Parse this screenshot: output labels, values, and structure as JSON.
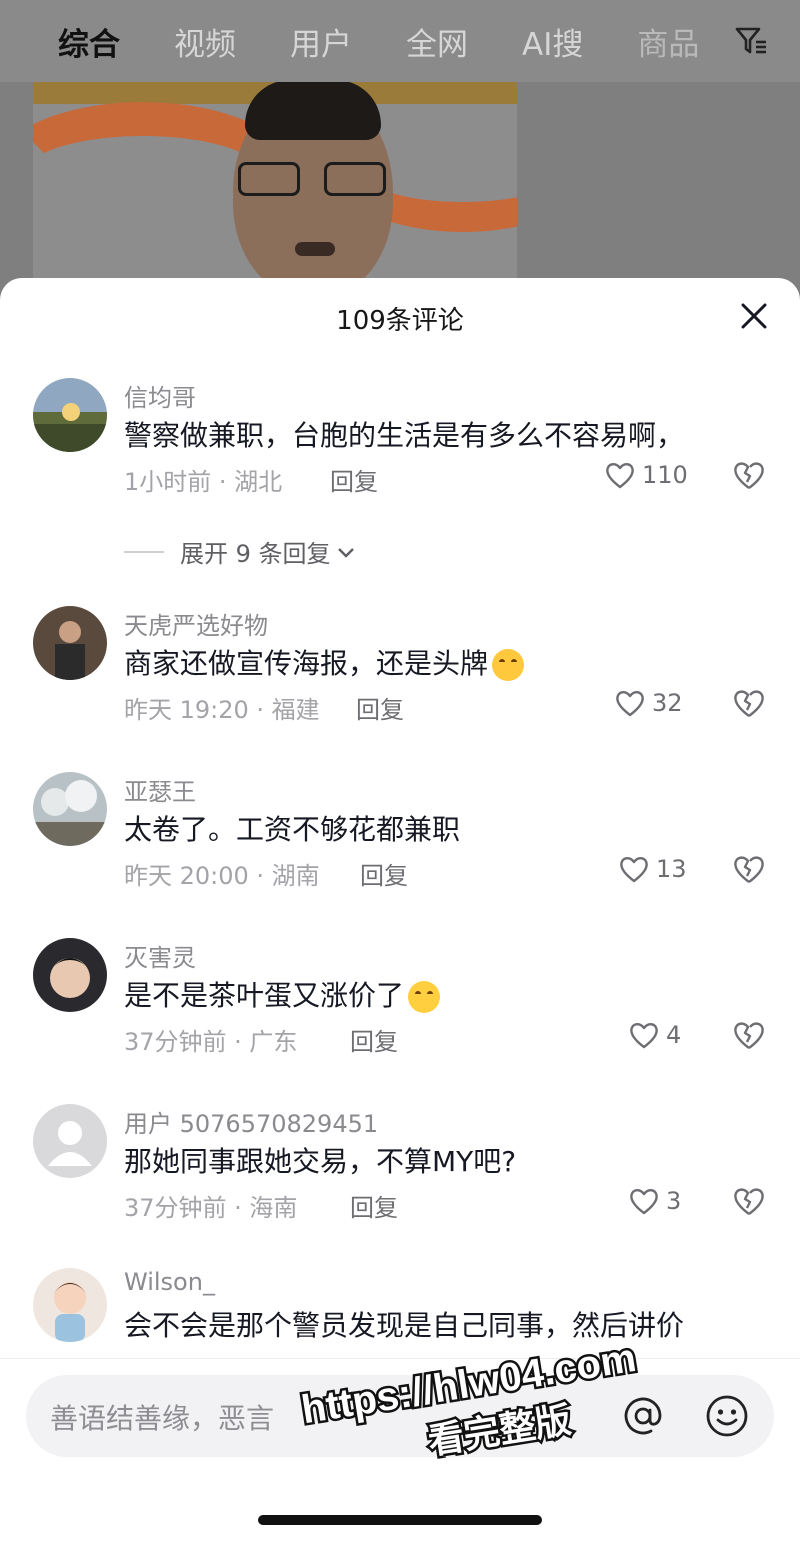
{
  "top_tabs": [
    {
      "label": "综合",
      "active": true
    },
    {
      "label": "视频",
      "active": false
    },
    {
      "label": "用户",
      "active": false
    },
    {
      "label": "全网",
      "active": false
    },
    {
      "label": "AI搜",
      "active": false
    },
    {
      "label": "商品",
      "active": false
    }
  ],
  "filter_icon": "filter-icon",
  "sheet": {
    "title": "109条评论",
    "close_icon": "close-icon"
  },
  "comments": [
    {
      "user": "信均哥",
      "text": "警察做兼职，台胞的生活是有多么不容易啊，",
      "time_location": "1小时前 · 湖北",
      "reply_label": "回复",
      "likes": "110"
    },
    {
      "user": "天虎严选好物",
      "text": "商家还做宣传海报，还是头牌",
      "emoji": "smirk-emoji",
      "time_location": "昨天 19:20 · 福建",
      "reply_label": "回复",
      "likes": "32"
    },
    {
      "user": "亚瑟王",
      "text": "太卷了。工资不够花都兼职",
      "time_location": "昨天 20:00 · 湖南",
      "reply_label": "回复",
      "likes": "13"
    },
    {
      "user": "灭害灵",
      "text": "是不是茶叶蛋又涨价了",
      "emoji": "rofl-emoji",
      "time_location": "37分钟前 · 广东",
      "reply_label": "回复",
      "likes": "4"
    },
    {
      "user": "用户 5076570829451",
      "text": "那她同事跟她交易，不算MY吧?",
      "time_location": "37分钟前 · 海南",
      "reply_label": "回复",
      "likes": "3"
    },
    {
      "user": "Wilson_",
      "text": "会不会是那个警员发现是自己同事，然后讲价"
    }
  ],
  "expand_replies": "展开 9 条回复",
  "input": {
    "placeholder": "善语结善缘，恶言",
    "at_icon": "at-icon",
    "emoji_icon": "emoji-icon"
  },
  "watermark": {
    "url": "https://hlw04.com",
    "text": "看完整版"
  },
  "colors": {
    "text_primary": "#161823",
    "text_secondary": "#8a8a8f",
    "overlay": "#7f7f7f"
  }
}
